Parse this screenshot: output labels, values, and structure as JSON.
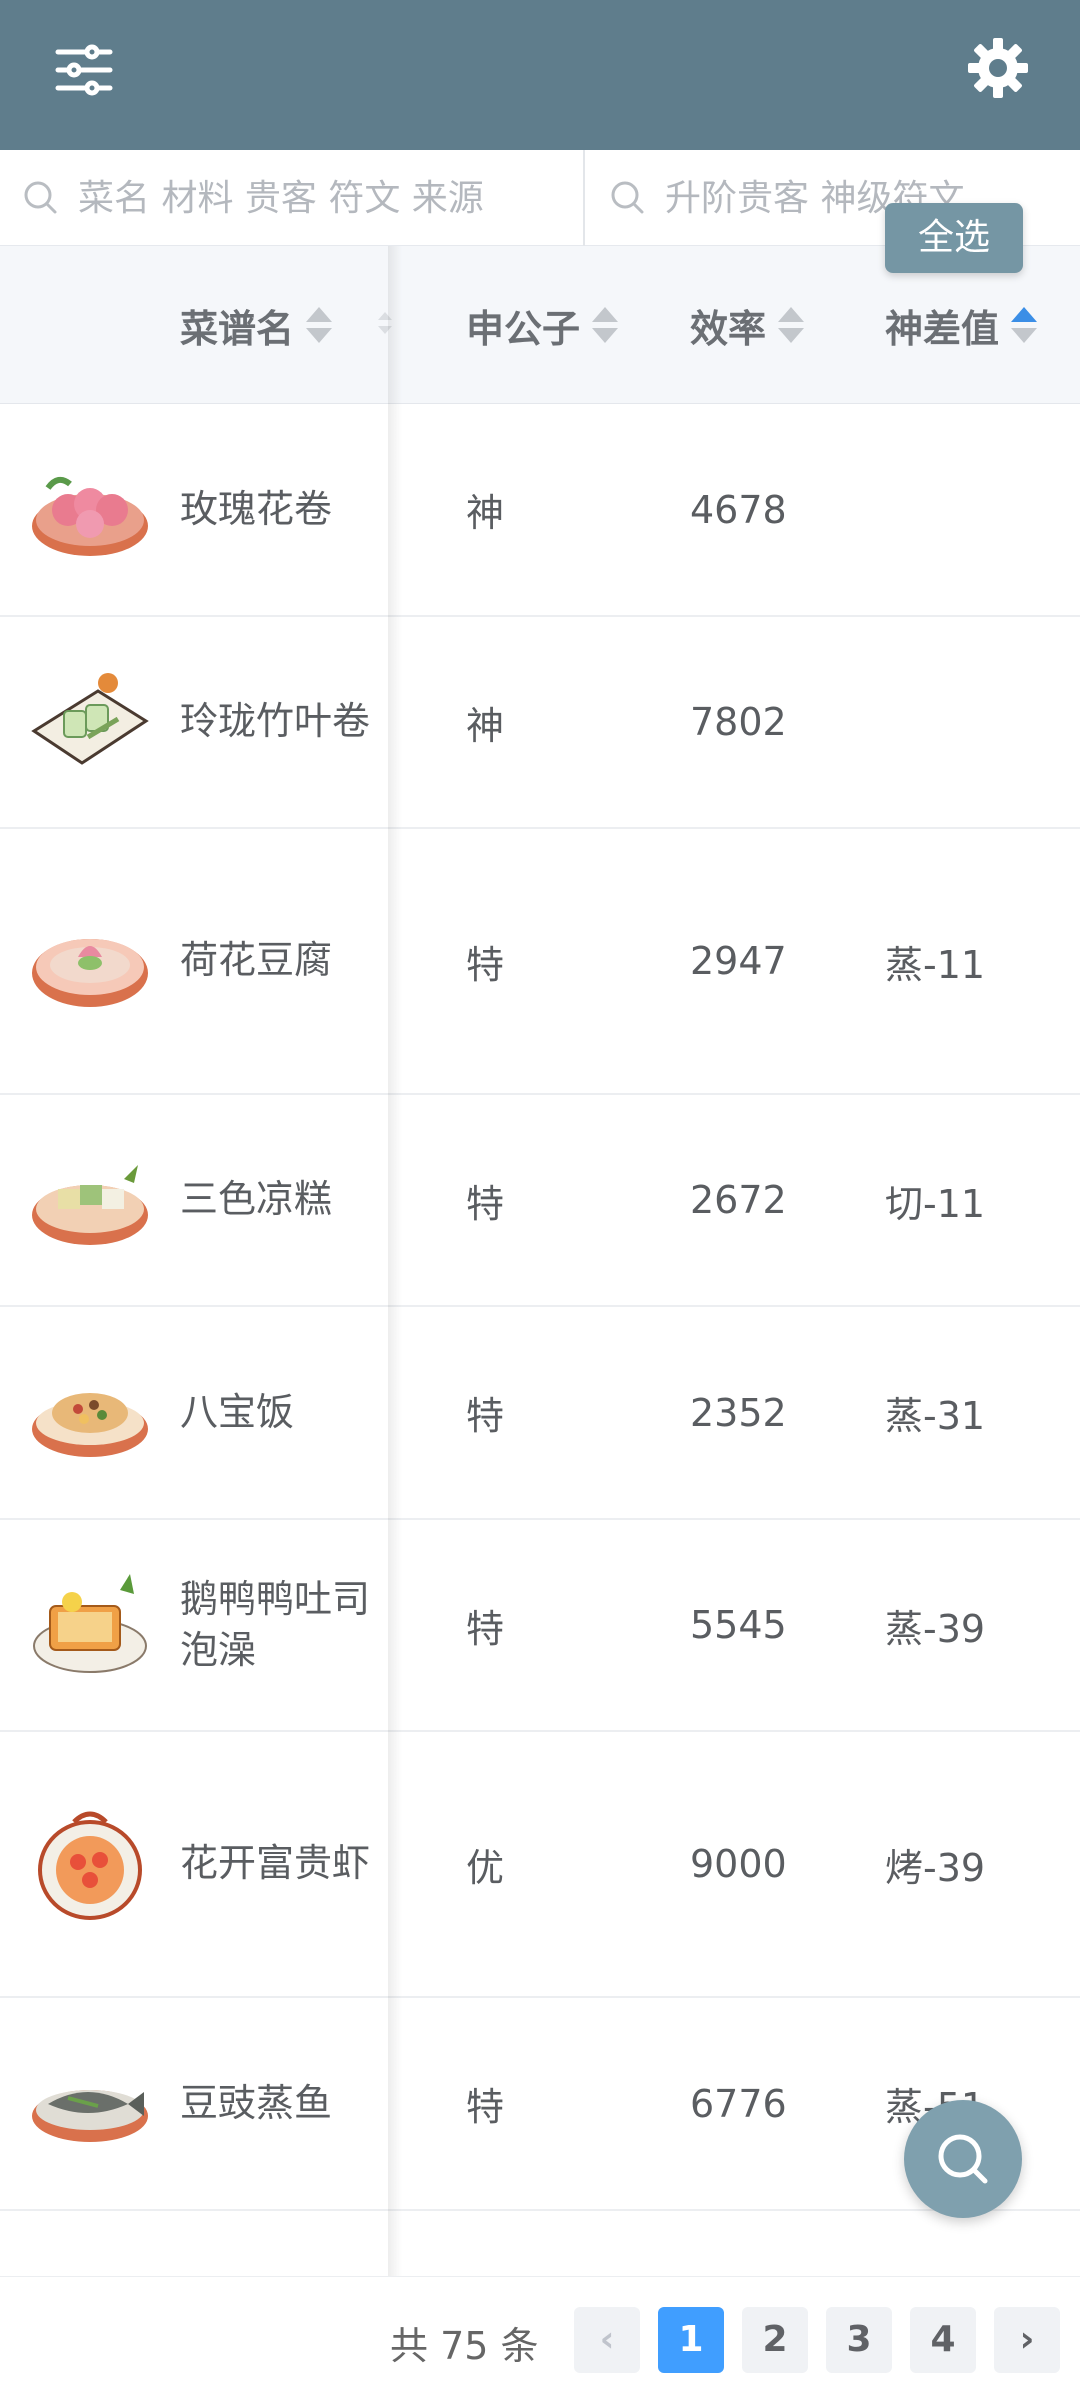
{
  "search": {
    "left_placeholder": "菜名 材料 贵客 符文 来源",
    "right_placeholder": "升阶贵客 神级符文",
    "select_all_label": "全选"
  },
  "table": {
    "headers": {
      "name": "菜谱名",
      "rank": "申公子",
      "efficiency": "效率",
      "difference": "神差值"
    },
    "rows": [
      {
        "name": "玫瑰花卷",
        "rank": "神",
        "efficiency": "4678",
        "difference": "",
        "icon": "rose-roll-dish-icon"
      },
      {
        "name": "玲珑竹叶卷",
        "rank": "神",
        "efficiency": "7802",
        "difference": "",
        "icon": "bamboo-leaf-roll-dish-icon"
      },
      {
        "name": "荷花豆腐",
        "rank": "特",
        "efficiency": "2947",
        "difference": "蒸-11",
        "icon": "lotus-tofu-dish-icon"
      },
      {
        "name": "三色凉糕",
        "rank": "特",
        "efficiency": "2672",
        "difference": "切-11",
        "icon": "tricolor-cake-dish-icon"
      },
      {
        "name": "八宝饭",
        "rank": "特",
        "efficiency": "2352",
        "difference": "蒸-31",
        "icon": "eight-treasure-rice-dish-icon"
      },
      {
        "name": "鹅鸭鸭吐司泡澡",
        "rank": "特",
        "efficiency": "5545",
        "difference": "蒸-39",
        "icon": "duck-toast-dish-icon"
      },
      {
        "name": "花开富贵虾",
        "rank": "优",
        "efficiency": "9000",
        "difference": "烤-39",
        "icon": "blooming-shrimp-dish-icon"
      },
      {
        "name": "豆豉蒸鱼",
        "rank": "特",
        "efficiency": "6776",
        "difference": "蒸-51",
        "icon": "steamed-fish-dish-icon"
      }
    ]
  },
  "pagination": {
    "total": "共 75 条",
    "prev": "‹",
    "next": "›",
    "pages": [
      "1",
      "2",
      "3",
      "4"
    ],
    "current": "1"
  },
  "colors": {
    "header_bg": "#5f7d8c",
    "accent": "#409eff",
    "select_all_bg": "#7596a4",
    "fab_bg": "#7fa0ae"
  }
}
